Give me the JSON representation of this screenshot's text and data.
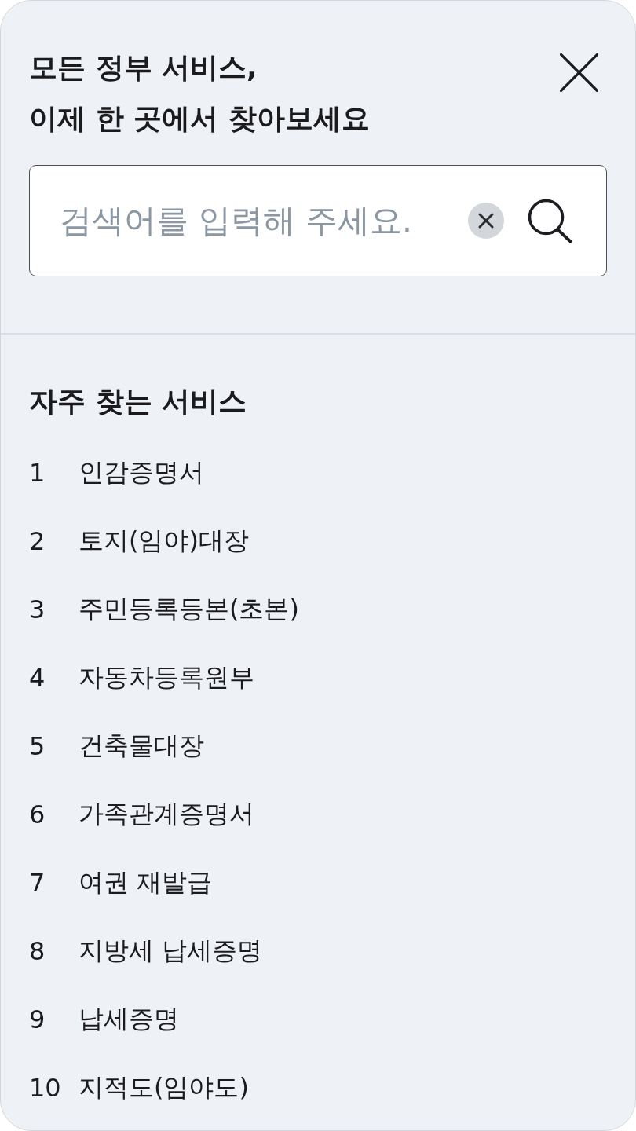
{
  "title": "모든 정부 서비스,\n이제 한 곳에서 찾아보세요",
  "search": {
    "placeholder": "검색어를 입력해 주세요."
  },
  "popular": {
    "heading": "자주 찾는 서비스",
    "items": [
      {
        "rank": "1",
        "label": "인감증명서"
      },
      {
        "rank": "2",
        "label": "토지(임야)대장"
      },
      {
        "rank": "3",
        "label": "주민등록등본(초본)"
      },
      {
        "rank": "4",
        "label": "자동차등록원부"
      },
      {
        "rank": "5",
        "label": "건축물대장"
      },
      {
        "rank": "6",
        "label": "가족관계증명서"
      },
      {
        "rank": "7",
        "label": "여권 재발급"
      },
      {
        "rank": "8",
        "label": "지방세 납세증명"
      },
      {
        "rank": "9",
        "label": "납세증명"
      },
      {
        "rank": "10",
        "label": "지적도(임야도)"
      }
    ]
  }
}
